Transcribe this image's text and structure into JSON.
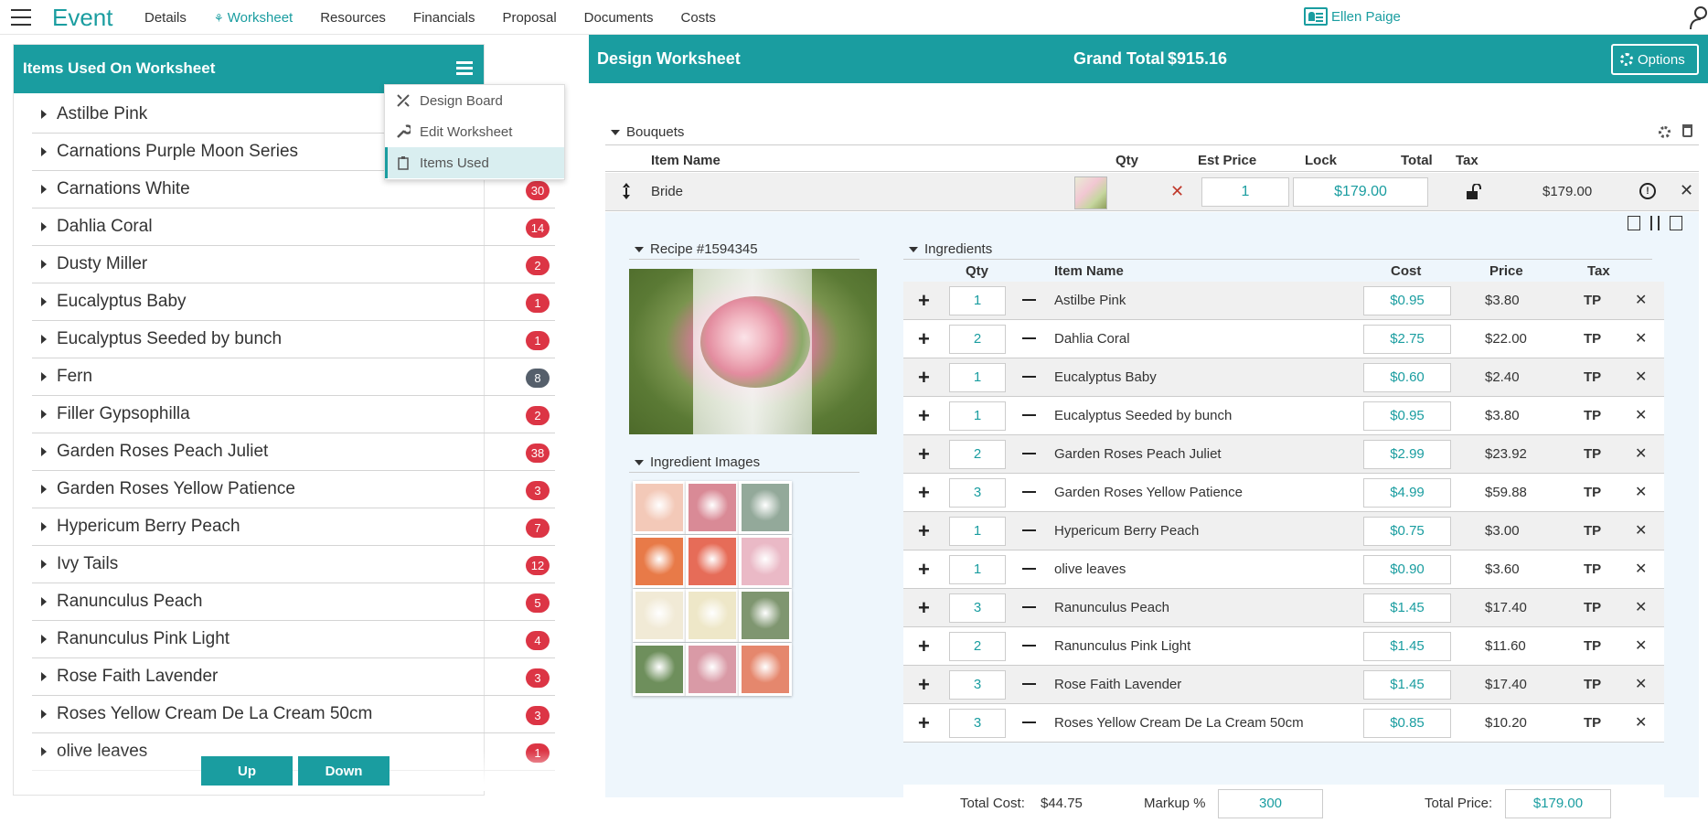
{
  "app": {
    "brand": "Event",
    "nav": [
      {
        "label": "Details",
        "active": false
      },
      {
        "label": "Worksheet",
        "active": true
      },
      {
        "label": "Resources",
        "active": false
      },
      {
        "label": "Financials",
        "active": false
      },
      {
        "label": "Proposal",
        "active": false
      },
      {
        "label": "Documents",
        "active": false
      },
      {
        "label": "Costs",
        "active": false
      }
    ],
    "user_name": "Ellen Paige",
    "accent_color": "#1a9da0"
  },
  "left": {
    "title": "Items Used On Worksheet",
    "items": [
      {
        "label": "Astilbe Pink",
        "count": ""
      },
      {
        "label": "Carnations Purple Moon Series",
        "count": ""
      },
      {
        "label": "Carnations White",
        "count": "30"
      },
      {
        "label": "Dahlia Coral",
        "count": "14"
      },
      {
        "label": "Dusty Miller",
        "count": "2"
      },
      {
        "label": "Eucalyptus Baby",
        "count": "1"
      },
      {
        "label": "Eucalyptus Seeded by bunch",
        "count": "1"
      },
      {
        "label": "Fern",
        "count": "8"
      },
      {
        "label": "Filler Gypsophilla",
        "count": "2"
      },
      {
        "label": "Garden Roses Peach Juliet",
        "count": "38"
      },
      {
        "label": "Garden Roses Yellow Patience",
        "count": "3"
      },
      {
        "label": "Hypericum Berry Peach",
        "count": "7"
      },
      {
        "label": "Ivy Tails",
        "count": "12"
      },
      {
        "label": "Ranunculus Peach",
        "count": "5"
      },
      {
        "label": "Ranunculus Pink Light",
        "count": "4"
      },
      {
        "label": "Rose Faith Lavender",
        "count": "3"
      },
      {
        "label": "Roses Yellow Cream De La Cream 50cm",
        "count": "3"
      },
      {
        "label": "olive leaves",
        "count": "1"
      }
    ],
    "up_label": "Up",
    "down_label": "Down",
    "menu": [
      {
        "label": "Design Board",
        "icon": "design-board-icon"
      },
      {
        "label": "Edit Worksheet",
        "icon": "wrench-icon"
      },
      {
        "label": "Items Used",
        "icon": "clipboard-icon"
      }
    ]
  },
  "worksheet": {
    "title": "Design Worksheet",
    "grand_total_label": "Grand Total",
    "grand_total": "$915.16",
    "options_label": "Options",
    "section": "Bouquets",
    "columns": {
      "item_name": "Item Name",
      "qty": "Qty",
      "est_price": "Est Price",
      "lock": "Lock",
      "total": "Total",
      "tax": "Tax"
    },
    "bouquet": {
      "name": "Bride",
      "qty": "1",
      "est_price": "$179.00",
      "total": "$179.00"
    },
    "recipe_label": "Recipe #1594345",
    "ingredient_images_label": "Ingredient Images",
    "ingredients_label": "Ingredients",
    "ing_columns": {
      "qty": "Qty",
      "item_name": "Item Name",
      "cost": "Cost",
      "price": "Price",
      "tax": "Tax"
    },
    "ingredients": [
      {
        "qty": "1",
        "name": "Astilbe Pink",
        "cost": "$0.95",
        "price": "$3.80",
        "tax": "TP"
      },
      {
        "qty": "2",
        "name": "Dahlia Coral",
        "cost": "$2.75",
        "price": "$22.00",
        "tax": "TP"
      },
      {
        "qty": "1",
        "name": "Eucalyptus Baby",
        "cost": "$0.60",
        "price": "$2.40",
        "tax": "TP"
      },
      {
        "qty": "1",
        "name": "Eucalyptus Seeded by bunch",
        "cost": "$0.95",
        "price": "$3.80",
        "tax": "TP"
      },
      {
        "qty": "2",
        "name": "Garden Roses Peach Juliet",
        "cost": "$2.99",
        "price": "$23.92",
        "tax": "TP"
      },
      {
        "qty": "3",
        "name": "Garden Roses Yellow Patience",
        "cost": "$4.99",
        "price": "$59.88",
        "tax": "TP"
      },
      {
        "qty": "1",
        "name": "Hypericum Berry Peach",
        "cost": "$0.75",
        "price": "$3.00",
        "tax": "TP"
      },
      {
        "qty": "1",
        "name": "olive leaves",
        "cost": "$0.90",
        "price": "$3.60",
        "tax": "TP"
      },
      {
        "qty": "3",
        "name": "Ranunculus Peach",
        "cost": "$1.45",
        "price": "$17.40",
        "tax": "TP"
      },
      {
        "qty": "2",
        "name": "Ranunculus Pink Light",
        "cost": "$1.45",
        "price": "$11.60",
        "tax": "TP"
      },
      {
        "qty": "3",
        "name": "Rose Faith Lavender",
        "cost": "$1.45",
        "price": "$17.40",
        "tax": "TP"
      },
      {
        "qty": "3",
        "name": "Roses Yellow Cream De La Cream 50cm",
        "cost": "$0.85",
        "price": "$10.20",
        "tax": "TP"
      }
    ],
    "totals": {
      "total_cost_label": "Total Cost:",
      "total_cost": "$44.75",
      "markup_label": "Markup %",
      "markup": "300",
      "total_price_label": "Total Price:",
      "total_price": "$179.00"
    },
    "ingredient_image_colors": [
      "#f3c9b8",
      "#d98a96",
      "#93a99a",
      "#e87a48",
      "#e66c58",
      "#eab9c6",
      "#f1ead6",
      "#eee7c8",
      "#7f9670",
      "#6e8f5c",
      "#d99aa6",
      "#e5876d"
    ]
  }
}
